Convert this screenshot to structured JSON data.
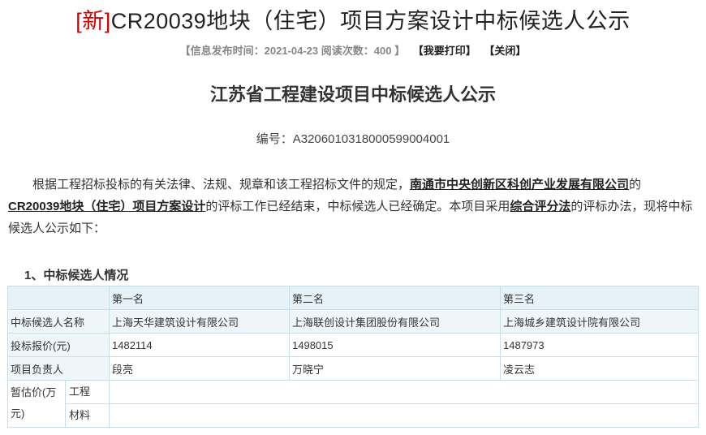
{
  "header": {
    "tag": "[新]",
    "title": "CR20039地块（住宅）项目方案设计中标候选人公示",
    "meta_prefix": "【信息发布时间：",
    "publish_date": "2021-04-23",
    "views_label": "阅读次数：",
    "views": "400",
    "meta_suffix": "】",
    "print_label": "【我要打印】",
    "close_label": "【关闭】"
  },
  "notice": {
    "heading": "江苏省工程建设项目中标候选人公示",
    "code_label": "编号：",
    "code": "A3206010318000599004001",
    "p1": "根据工程招标投标的有关法律、法规、规章和该工程招标文件的规定，",
    "company": "南通市中央创新区科创产业发展有限公司",
    "p2": "的",
    "project": "CR20039地块（住宅）项目方案设计",
    "p3": "的评标工作已经结束，中标候选人已经确定。本项目采用",
    "method": "综合评分法",
    "p4": "的评标办法，现将中标候选人公示如下："
  },
  "section1": {
    "title": "1、中标候选人情况"
  },
  "table": {
    "ranks": [
      "第一名",
      "第二名",
      "第三名"
    ],
    "rows": [
      {
        "label": "中标候选人名称",
        "values": [
          "上海天华建筑设计有限公司",
          "上海联创设计集团股份有限公司",
          "上海城乡建筑设计院有限公司"
        ]
      },
      {
        "label": "投标报价(元)",
        "values": [
          "1482114",
          "1498015",
          "1487973"
        ]
      },
      {
        "label": "项目负责人",
        "values": [
          "段亮",
          "万晓宁",
          "凌云志"
        ]
      }
    ],
    "estimate_label": "暂估价(万元)",
    "estimate_sub": [
      "工程",
      "材料"
    ]
  }
}
